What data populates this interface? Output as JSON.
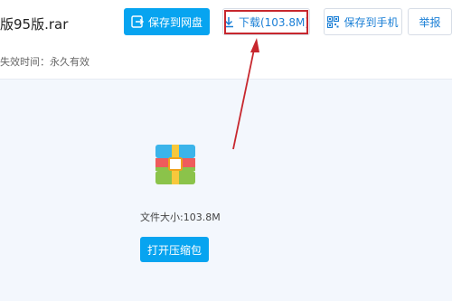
{
  "file": {
    "name": "版95版.rar",
    "expire_label": "失效时间：",
    "expire_value": "永久有效"
  },
  "toolbar": {
    "save_label": "保存到网盘",
    "download_label": "下载(103.8M)",
    "phone_label": "保存到手机",
    "report_label": "举报"
  },
  "preview": {
    "size_label": "文件大小:",
    "size_value": "103.8M",
    "open_label": "打开压缩包"
  },
  "icons": {
    "save": "save-to-cloud-icon",
    "download": "download-icon",
    "phone": "qr-code-icon",
    "archive": "rar-archive-icon"
  },
  "colors": {
    "accent": "#07a4f0",
    "highlight": "#c7272e",
    "link": "#1a7fd6"
  }
}
